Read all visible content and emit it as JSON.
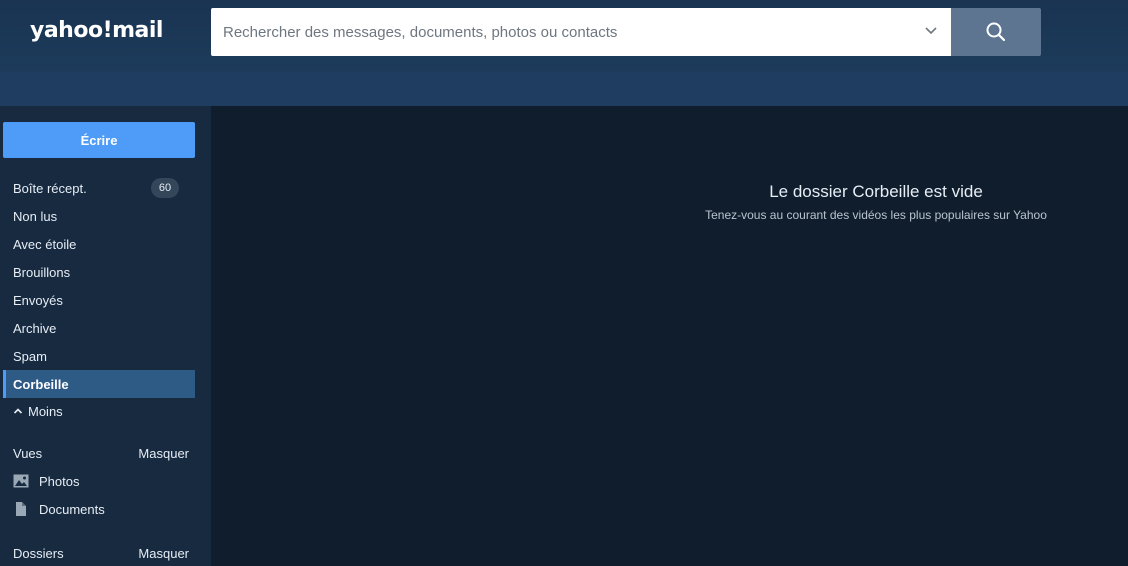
{
  "header": {
    "logo_text": "yahoo!mail",
    "search": {
      "placeholder": "Rechercher des messages, documents, photos ou contacts"
    },
    "icons": {
      "search_dropdown": "chevron-down-icon",
      "search_button": "magnifier-icon"
    }
  },
  "sidebar": {
    "compose_label": "Écrire",
    "folders": [
      {
        "label": "Boîte récept.",
        "badge": "60"
      },
      {
        "label": "Non lus"
      },
      {
        "label": "Avec étoile"
      },
      {
        "label": "Brouillons"
      },
      {
        "label": "Envoyés"
      },
      {
        "label": "Archive"
      },
      {
        "label": "Spam"
      },
      {
        "label": "Corbeille",
        "active": true
      }
    ],
    "less_label": "Moins",
    "views": {
      "title": "Vues",
      "toggle": "Masquer",
      "items": [
        {
          "label": "Photos",
          "icon": "image-icon"
        },
        {
          "label": "Documents",
          "icon": "document-icon"
        }
      ]
    },
    "folders_section": {
      "title": "Dossiers",
      "toggle": "Masquer"
    }
  },
  "main": {
    "empty_title": "Le dossier Corbeille est vide",
    "empty_subtitle": "Tenez-vous au courant des vidéos les plus populaires sur Yahoo"
  },
  "colors": {
    "accent": "#4e9cf7",
    "header_bg": "#1d3b5b",
    "sidebar_bg": "#172a40",
    "main_bg": "#0f1d2c",
    "active_item_bg": "#2e5a86"
  }
}
